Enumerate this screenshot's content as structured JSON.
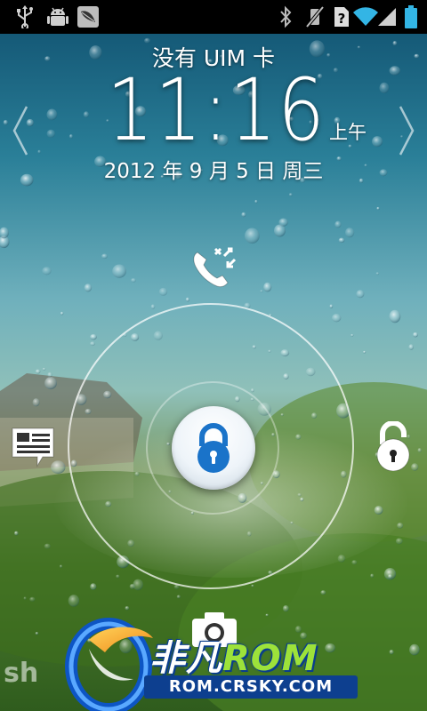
{
  "status_bar": {
    "icons_left": [
      "usb-icon",
      "android-debug-icon",
      "leaf-notification-icon"
    ],
    "icons_right": [
      "bluetooth-icon",
      "vibrate-icon",
      "no-sim-icon",
      "wifi-icon",
      "signal-icon",
      "battery-icon"
    ]
  },
  "lockscreen": {
    "carrier": "没有 UIM 卡",
    "time": "11:16",
    "ampm": "上午",
    "date": "2012 年 9 月 5 日 周三"
  },
  "targets": {
    "top": "missed-call-icon",
    "left": "message-icon",
    "right": "unlock-icon",
    "bottom": "camera-icon"
  },
  "watermark": {
    "left_text": "sh",
    "brand_name_cn": "非凡",
    "brand_name_rom": "ROM",
    "url": "ROM.CRSKY.COM"
  },
  "colors": {
    "status_bar_bg": "#000000",
    "lock_icon": "#1a73c9",
    "watermark_blue": "#0d3f8f",
    "watermark_green": "#9de23a",
    "battery": "#33b5e5"
  }
}
